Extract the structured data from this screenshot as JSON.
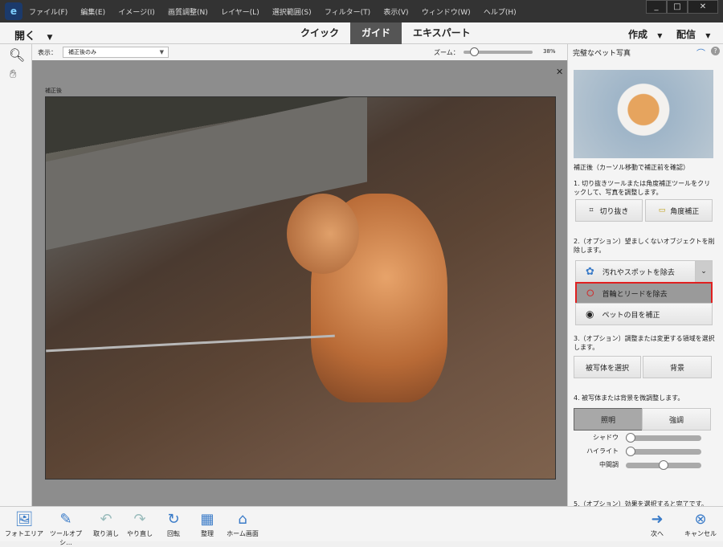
{
  "titlebar": {
    "menus": [
      "ファイル(F)",
      "編集(E)",
      "イメージ(I)",
      "画質調整(N)",
      "レイヤー(L)",
      "選択範囲(S)",
      "フィルター(T)",
      "表示(V)",
      "ウィンドウ(W)",
      "ヘルプ(H)"
    ],
    "minimize": "_",
    "maximize": "□",
    "close": "✕"
  },
  "modebar": {
    "open": "開く",
    "tabs": [
      "クイック",
      "ガイド",
      "エキスパート"
    ],
    "create": "作成",
    "share": "配信"
  },
  "options": {
    "view_label": "表示：",
    "view_value": "補正後のみ",
    "zoom_label": "ズーム：",
    "zoom_value": "38%",
    "zoom_fraction": 0.1
  },
  "canvas": {
    "label": "補正後",
    "close": "✕"
  },
  "panel": {
    "title": "完璧なペット写真",
    "caption": "補正後（カーソル移動で補正前を確認）",
    "step1": "1. 切り抜きツールまたは角度補正ツールをクリックして、写真を調整します。",
    "crop": "切り抜き",
    "straighten": "角度補正",
    "step2": "2.（オプション）望ましくないオブジェクトを削除します。",
    "spot": "汚れやスポットを除去",
    "collar": "首輪とリードを除去",
    "eye": "ペットの目を補正",
    "step3": "3.（オプション）調整または変更する領域を選択します。",
    "subject": "被写体を選択",
    "background": "背景",
    "step4": "4. 被写体または背景を微調整します。",
    "lighting": "照明",
    "enhance": "強調",
    "sliders": [
      {
        "label": "シャドウ",
        "value": 0
      },
      {
        "label": "ハイライト",
        "value": 0
      },
      {
        "label": "中間調",
        "value": 0.5
      }
    ],
    "step5": "5.（オプション）効果を選択すると完了です。"
  },
  "bottom": {
    "items": [
      "フォトエリア",
      "ツールオプシ...",
      "取り消し",
      "やり直し",
      "回転",
      "整理",
      "ホーム画面"
    ],
    "next": "次へ",
    "cancel": "キャンセル"
  },
  "colors": {
    "highlight": "#e02020",
    "accent": "#3a7bc8"
  }
}
